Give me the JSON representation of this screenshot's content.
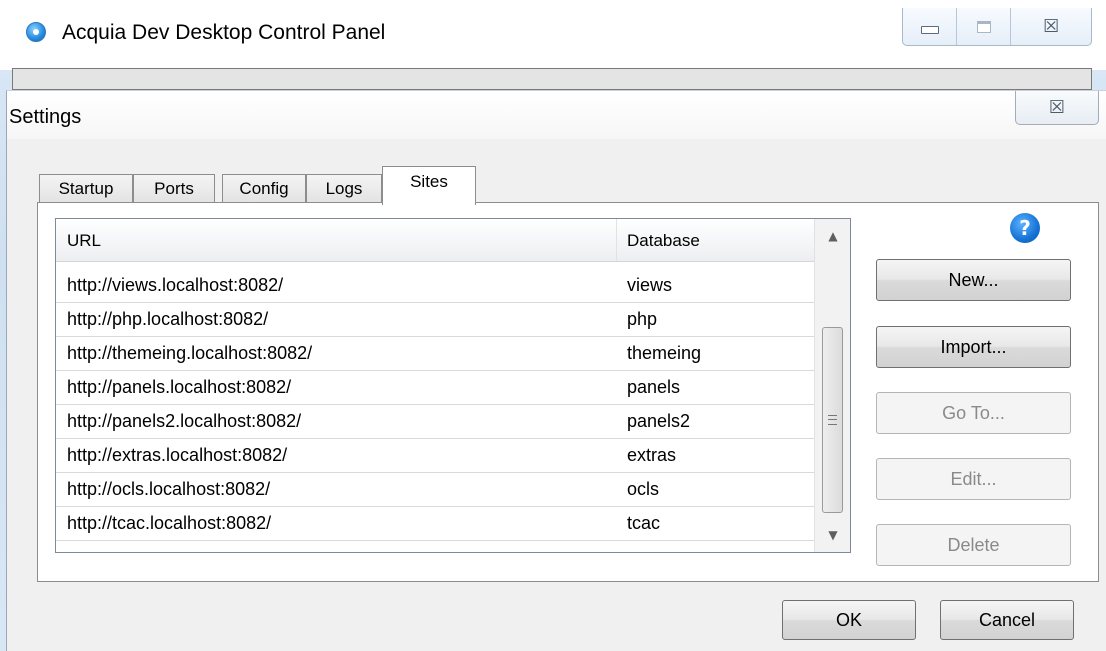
{
  "outer_window": {
    "title": "Acquia Dev Desktop Control Panel",
    "controls": {
      "minimize_icon": "minimize-icon",
      "maximize_icon": "maximize-icon",
      "close_glyph": "☒"
    }
  },
  "dialog": {
    "title": "Settings",
    "close_glyph": "☒",
    "tabs": [
      {
        "label": "Startup",
        "active": false
      },
      {
        "label": "Ports",
        "active": false
      },
      {
        "label": "Config",
        "active": false
      },
      {
        "label": "Logs",
        "active": false
      },
      {
        "label": "Sites",
        "active": true
      }
    ],
    "sites_table": {
      "columns": [
        "URL",
        "Database"
      ],
      "rows": [
        {
          "url": "http://views.localhost:8082/",
          "database": "views"
        },
        {
          "url": "http://php.localhost:8082/",
          "database": "php"
        },
        {
          "url": "http://themeing.localhost:8082/",
          "database": "themeing"
        },
        {
          "url": "http://panels.localhost:8082/",
          "database": "panels"
        },
        {
          "url": "http://panels2.localhost:8082/",
          "database": "panels2"
        },
        {
          "url": "http://extras.localhost:8082/",
          "database": "extras"
        },
        {
          "url": "http://ocls.localhost:8082/",
          "database": "ocls"
        },
        {
          "url": "http://tcac.localhost:8082/",
          "database": "tcac"
        }
      ]
    },
    "help_glyph": "?",
    "side_buttons": {
      "new": "New...",
      "import": "Import...",
      "goto": "Go To...",
      "edit": "Edit...",
      "delete": "Delete"
    },
    "bottom_buttons": {
      "ok": "OK",
      "cancel": "Cancel"
    },
    "colors": {
      "accent_blue": "#1673d6",
      "disabled_text": "#8a8a8a"
    }
  }
}
